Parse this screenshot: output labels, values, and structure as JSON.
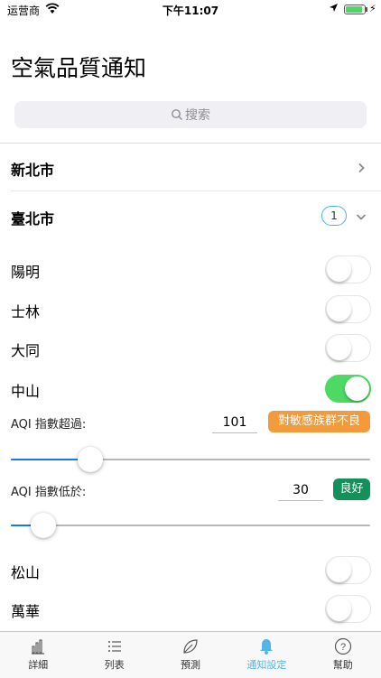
{
  "status_bar": {
    "carrier": "运营商",
    "time": "下午11:07",
    "battery_level": 0.9
  },
  "page_title": "空氣品質通知",
  "search": {
    "placeholder": "搜索"
  },
  "cities": [
    {
      "name": "新北市",
      "expanded": false
    },
    {
      "name": "臺北市",
      "expanded": true,
      "count": "1"
    }
  ],
  "districts": [
    {
      "name": "陽明",
      "enabled": false
    },
    {
      "name": "士林",
      "enabled": false
    },
    {
      "name": "大同",
      "enabled": false
    },
    {
      "name": "中山",
      "enabled": true
    },
    {
      "name": "松山",
      "enabled": false
    },
    {
      "name": "萬華",
      "enabled": false
    }
  ],
  "aqi_above": {
    "label": "AQI 指數超過:",
    "value": "101",
    "badge": "對敏感族群不良",
    "badge_color": "#f39a3a",
    "slider_level": 0.22
  },
  "aqi_below": {
    "label": "AQI 指數低於:",
    "value": "30",
    "badge": "良好",
    "badge_color": "#14905a",
    "slider_level": 0.09
  },
  "tabs": [
    {
      "label": "詳細",
      "icon": "bar-chart-icon",
      "active": false
    },
    {
      "label": "列表",
      "icon": "list-icon",
      "active": false
    },
    {
      "label": "預測",
      "icon": "leaf-icon",
      "active": false
    },
    {
      "label": "通知設定",
      "icon": "bell-icon",
      "active": true
    },
    {
      "label": "幫助",
      "icon": "help-icon",
      "active": false
    }
  ],
  "colors": {
    "accent": "#54b5e8",
    "toggle_on": "#4cd964",
    "slider_fill": "#1478f5"
  }
}
